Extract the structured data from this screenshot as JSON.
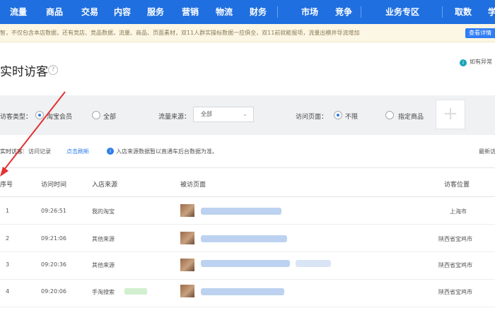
{
  "nav": {
    "items": [
      "流量",
      "商品",
      "交易",
      "内容",
      "服务",
      "营销",
      "物流",
      "财务",
      "市场",
      "竞争",
      "业务专区",
      "取数",
      "学"
    ]
  },
  "notice": {
    "text": "智，不仅包含本店数据，还有竞店、竞品数据，流量、商品、页面素材，双11人群实操标数据一应俱全，双11前就能报项，流量出模井导流增加",
    "button": "查看详情"
  },
  "page": {
    "title": "实时访客",
    "help": "?",
    "top_right_link": "如有异常"
  },
  "filter": {
    "visitor_type_label": "访客类型：",
    "opt_taobao_member": "淘宝会员",
    "opt_all": "全部",
    "source_label": "流量来源：",
    "source_value": "全部",
    "page_label": "访问页面：",
    "opt_unlimited": "不限",
    "opt_specific_item": "指定商品",
    "add": "+"
  },
  "tabs": {
    "left": "实时访客",
    "sep": "|",
    "records": "访问记录",
    "refresh": "点击刷新",
    "info_icon": "i",
    "info": "入店来源数据暂以直通车后台数据为准。",
    "right": "最新访"
  },
  "table": {
    "headers": [
      "序号",
      "访问时间",
      "入店来源",
      "被访页面",
      "访客位置"
    ],
    "rows": [
      {
        "index": "1",
        "time": "09:26:51",
        "source": "我的淘宝",
        "location": "上海市"
      },
      {
        "index": "2",
        "time": "09:21:06",
        "source": "其他来源",
        "location": "陕西省宝鸡市"
      },
      {
        "index": "3",
        "time": "09:20:36",
        "source": "其他来源",
        "location": "陕西省宝鸡市"
      },
      {
        "index": "4",
        "time": "09:20:06",
        "source": "手淘搜索",
        "location": "陕西省宝鸡市"
      }
    ]
  },
  "colors": {
    "nav_bg": "#1f6fe0",
    "link": "#2b7de9",
    "arrow": "#e23232"
  }
}
